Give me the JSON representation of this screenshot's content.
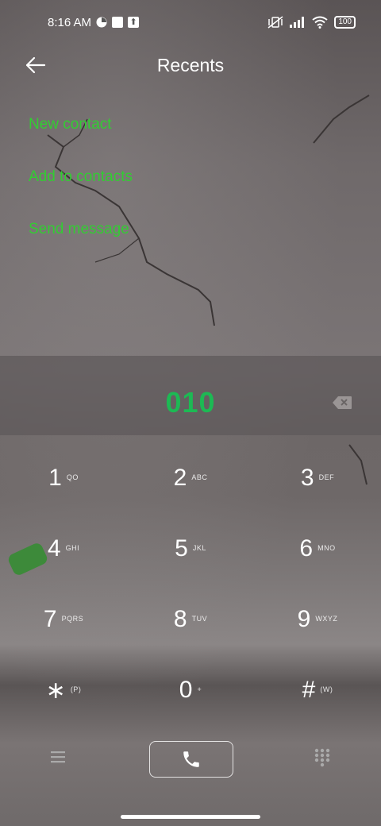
{
  "status_bar": {
    "time": "8:16 AM",
    "battery": "100"
  },
  "header": {
    "title": "Recents"
  },
  "menu": {
    "items": [
      {
        "label": "New contact"
      },
      {
        "label": "Add to contacts"
      },
      {
        "label": "Send message"
      }
    ]
  },
  "dialer": {
    "number": "010"
  },
  "keypad": {
    "keys": [
      {
        "digit": "1",
        "letters": "QO"
      },
      {
        "digit": "2",
        "letters": "ABC"
      },
      {
        "digit": "3",
        "letters": "DEF"
      },
      {
        "digit": "4",
        "letters": "GHI"
      },
      {
        "digit": "5",
        "letters": "JKL"
      },
      {
        "digit": "6",
        "letters": "MNO"
      },
      {
        "digit": "7",
        "letters": "PQRS"
      },
      {
        "digit": "8",
        "letters": "TUV"
      },
      {
        "digit": "9",
        "letters": "WXYZ"
      },
      {
        "digit": "∗",
        "letters": "(P)"
      },
      {
        "digit": "0",
        "letters": "+"
      },
      {
        "digit": "#",
        "letters": "(W)"
      }
    ]
  },
  "colors": {
    "accent": "#33cc33",
    "number": "#1db954"
  },
  "icons": {
    "back": "arrow-left-icon",
    "backspace": "backspace-icon",
    "menu": "hamburger-menu-icon",
    "call": "phone-icon",
    "keypad": "dialpad-grid-icon"
  }
}
